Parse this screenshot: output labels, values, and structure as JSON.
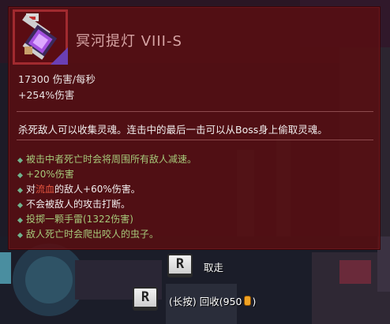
{
  "colors": {
    "panel_bg": "#580e12",
    "name": "#d6a4a4",
    "affix": "#a6c97a",
    "highlight": "#e4553f",
    "coin": "#f0a324"
  },
  "item": {
    "name": "冥河提灯 VIII-S",
    "icon": "stygian-lantern-icon",
    "stats": [
      "17300 伤害/每秒",
      "+254%伤害"
    ],
    "description": "杀死敌人可以收集灵魂。连击中的最后一击可以从Boss身上偷取灵魂。",
    "affixes": [
      {
        "text": "被击中者死亡时会将周围所有敌人减速。"
      },
      {
        "text": "+20%伤害"
      },
      {
        "pre": "对",
        "hl": "流血",
        "post": "的敌人+60%伤害。"
      },
      {
        "text": "不会被敌人的攻击打断。"
      },
      {
        "text": "投掷一颗手雷(1322伤害)"
      },
      {
        "text": "敌人死亡时会爬出咬人的虫子。"
      }
    ]
  },
  "prompts": {
    "pickup": {
      "key": "R",
      "label": "取走"
    },
    "recycle": {
      "key": "R",
      "hold": "(长按)",
      "label": "回收",
      "open": "(",
      "amount": "950",
      "close": ")",
      "icon": "gold-coin-icon"
    }
  }
}
